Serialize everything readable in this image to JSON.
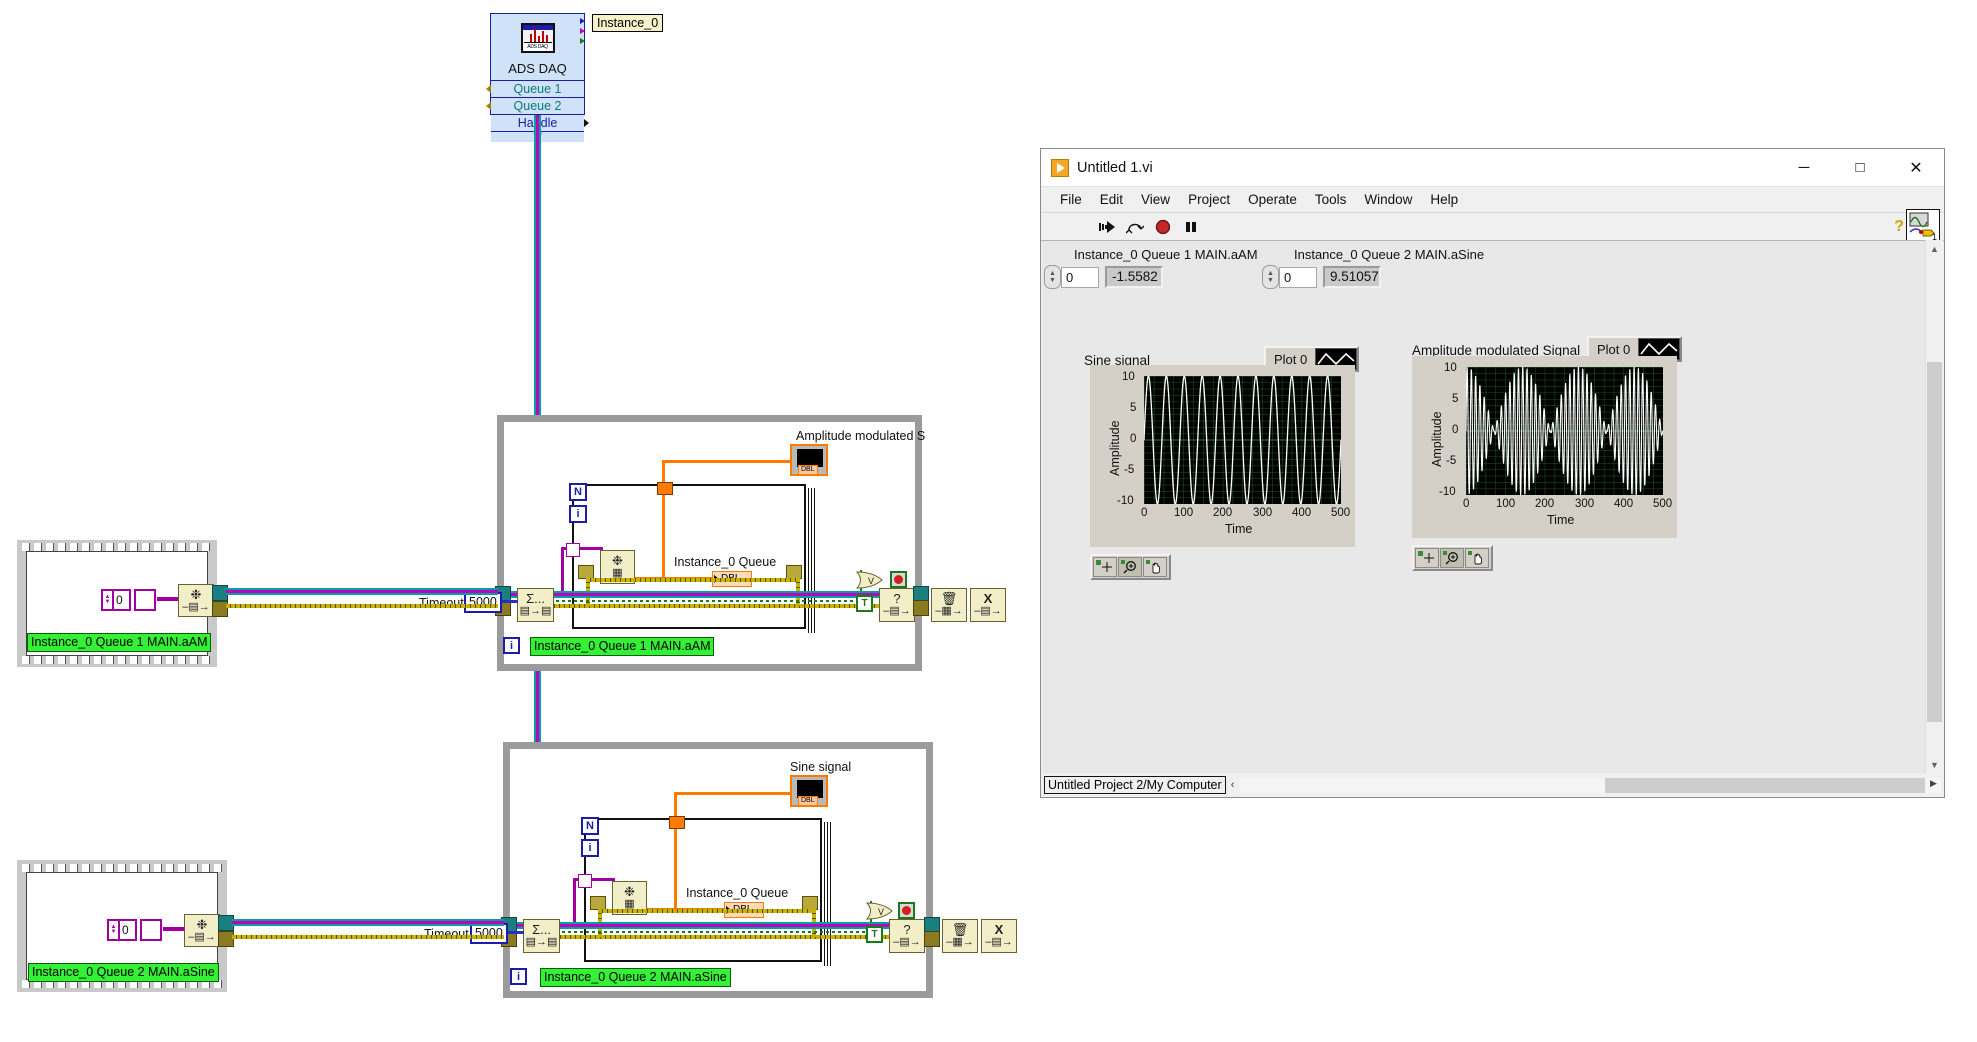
{
  "block_diagram": {
    "daq_node": {
      "title": "ADS DAQ",
      "icon_label": "ADS DAQ",
      "rows": [
        "Queue 1",
        "Queue 2",
        "Handle"
      ],
      "instance_label": "Instance_0"
    },
    "loops": [
      {
        "id": "am-loop",
        "graph_label": "Amplitude modulated S",
        "queue_label": "Instance_0 Queue",
        "dbl_label": "DBL",
        "timeout_label": "Timeout",
        "timeout_value": "5000",
        "loop_label": "Instance_0 Queue 1 MAIN.aAM",
        "iter_symbol": "i",
        "n_symbol": "N",
        "true_const": "T"
      },
      {
        "id": "sine-loop",
        "graph_label": "Sine signal",
        "queue_label": "Instance_0 Queue",
        "dbl_label": "DBL",
        "timeout_label": "Timeout",
        "timeout_value": "5000",
        "loop_label": "Instance_0 Queue 2 MAIN.aSine",
        "iter_symbol": "i",
        "n_symbol": "N",
        "true_const": "T"
      }
    ],
    "subvi_frames": [
      {
        "id": "frame-aam",
        "label": "Instance_0 Queue 1 MAIN.aAM",
        "index_value": "0"
      },
      {
        "id": "frame-asine",
        "label": "Instance_0 Queue 2 MAIN.aSine",
        "index_value": "0"
      }
    ],
    "node_glyphs": {
      "obtain_queue": "Σ...",
      "queue_status": "?",
      "release_queue": "Ὕ1",
      "destroy_queue": "X"
    }
  },
  "front_panel": {
    "window": {
      "title": "Untitled 1.vi",
      "minimize": "─",
      "maximize": "□",
      "close": "✕"
    },
    "menu": [
      "File",
      "Edit",
      "View",
      "Project",
      "Operate",
      "Tools",
      "Window",
      "Help"
    ],
    "toolbar": {
      "run": "run-arrow",
      "run_continuously": "run-continuously",
      "abort": "abort-execution",
      "pause": "pause",
      "help": "?",
      "vi_icon_number": "1"
    },
    "readouts": [
      {
        "caption": "Instance_0 Queue 1 MAIN.aAM",
        "index": "0",
        "value": "-1.5582"
      },
      {
        "caption": "Instance_0 Queue 2 MAIN.aSine",
        "index": "0",
        "value": "9.51057"
      }
    ],
    "status_bar": {
      "target": "Untitled Project 2/My Computer",
      "arrow": "‹"
    }
  },
  "chart_data": [
    {
      "type": "line",
      "id": "sine-graph",
      "title": "Sine signal",
      "legend": {
        "label": "Plot 0",
        "position": "top-right"
      },
      "xlabel": "Time",
      "ylabel": "Amplitude",
      "xlim": [
        0,
        500
      ],
      "ylim": [
        -10,
        10
      ],
      "xticks": [
        0,
        100,
        200,
        300,
        400,
        500
      ],
      "yticks": [
        -10,
        -5,
        0,
        5,
        10
      ],
      "grid": true,
      "grid_color": "#1b5e20",
      "background": "#000000",
      "trace_color": "#ffffff",
      "description": "Continuous sine wave, amplitude 10, about 11 cycles across 500 samples",
      "waveform": {
        "shape": "sine",
        "amplitude": 10,
        "cycles": 11,
        "phase": 0,
        "samples": 500
      }
    },
    {
      "type": "line",
      "id": "am-graph",
      "title": "Amplitude modulated Signal",
      "legend": {
        "label": "Plot 0",
        "position": "top-right"
      },
      "xlabel": "Time",
      "ylabel": "Amplitude",
      "xlim": [
        0,
        500
      ],
      "ylim": [
        -10,
        10
      ],
      "xticks": [
        0,
        100,
        200,
        300,
        400,
        500
      ],
      "yticks": [
        -10,
        -5,
        0,
        5,
        10
      ],
      "grid": true,
      "grid_color": "#1b5e20",
      "background": "#000000",
      "trace_color": "#ffffff",
      "description": "Amplitude modulated carrier, peak amplitude 10, dense carrier with slow envelope",
      "waveform": {
        "shape": "am",
        "amplitude": 10,
        "carrier_cycles": 46,
        "envelope_cycles": 3.5,
        "samples": 500
      }
    }
  ],
  "colors": {
    "diagram_bg": "#ffffff",
    "loop_border": "#9b9b9b",
    "error_wire": "#c8b400",
    "cluster_wire_a": "#00a0a0",
    "cluster_wire_b": "#c000c0",
    "orange_wire": "#ff7b00",
    "node_fill": "#f2eec8",
    "green_label": "#35f135",
    "daq_fill": "#cfe2f7",
    "plot_bg": "#000000",
    "plot_grid": "#1b5e20",
    "panel_gray": "#d4d0c8"
  }
}
